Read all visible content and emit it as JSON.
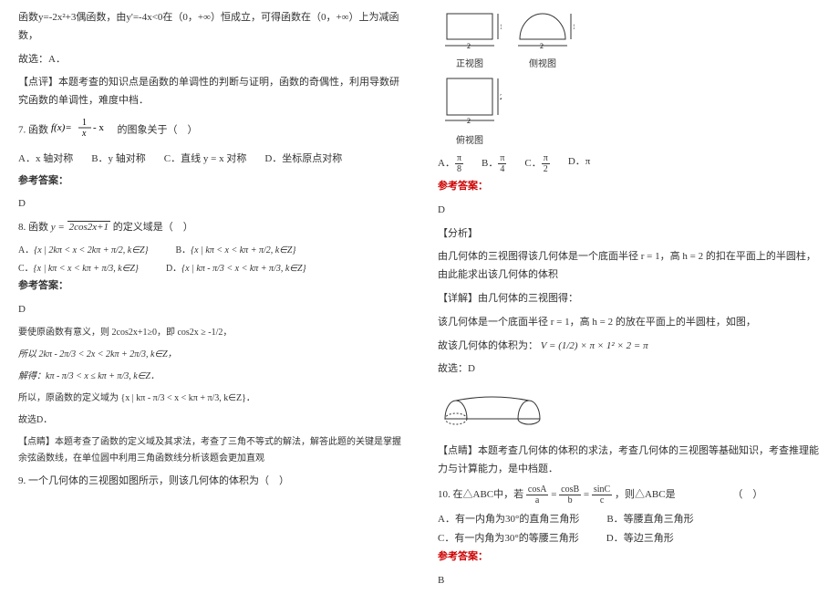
{
  "left": {
    "p1": "函数y=-2x²+3偶函数，由y'=-4x<0在（0，+∞）恒成立，可得函数在（0，+∞）上为减函数，",
    "p2": "故选：A．",
    "p3": "【点评】本题考查的知识点是函数的单调性的判断与证明，函数的奇偶性，利用导数研究函数的单调性，难度中档．",
    "q7_label": "7. 函数",
    "q7_rest": " 的图象关于（　）",
    "q7_optA": "A．x 轴对称",
    "q7_optB": "B．y 轴对称",
    "q7_optC": "C．直线 y = x 对称",
    "q7_optD": "D．坐标原点对称",
    "ans7_label": "参考答案：",
    "ans7": "D",
    "q8_label": "8. 函数",
    "q8_expr": "y = √(2cos2x+1)",
    "q8_rest": "  的定义域是（　）",
    "q8_optA_prefix": "A．",
    "q8_optA": "{x | 2kπ < x < 2kπ + π/2, k∈Z}",
    "q8_optB_prefix": "B．",
    "q8_optB": "{x | kπ < x < kπ + π/2, k∈Z}",
    "q8_optC_prefix": "C．",
    "q8_optC": "{x | kπ < x < kπ + π/3, k∈Z}",
    "q8_optD_prefix": "D．",
    "q8_optD": "{x | kπ - π/3 < x < kπ + π/3, k∈Z}",
    "ans8_label": "参考答案：",
    "ans8": "D",
    "sol8_1": "要使原函数有意义，则 2cos2x+1≥0，即 cos2x ≥ -1/2，",
    "sol8_2": "所以 2kπ - 2π/3 < 2x < 2kπ + 2π/3, k∈Z，",
    "sol8_3": "解得：kπ - π/3 < x ≤ kπ + π/3, k∈Z．",
    "sol8_4": "所以，原函数的定义域为 {x | kπ - π/3 < x < kπ + π/3, k∈Z}．",
    "sol8_5": "故选D．",
    "sol8_6": "【点睛】本题考查了函数的定义域及其求法，考查了三角不等式的解法，解答此题的关键是掌握余弦函数线，在单位圆中利用三角函数线分析该题会更加直观",
    "q9": "9. 一个几何体的三视图如图所示，则该几何体的体积为（　）"
  },
  "right": {
    "fig_front": "正视图",
    "fig_side": "侧视图",
    "fig_top": "俯视图",
    "q9_optA": "A．π/8",
    "q9_optB": "B．π/4",
    "q9_optC": "C．π/2",
    "q9_optD": "D．π",
    "ans9_label": "参考答案：",
    "ans9": "D",
    "analysis_label": "【分析】",
    "analysis1": "由几何体的三视图得该几何体是一个底面半径 r = 1，高 h = 2 的扣在平面上的半圆柱，由此能求出该几何体的体积",
    "detail_label": "【详解】由几何体的三视图得：",
    "detail1": "该几何体是一个底面半径 r = 1，高 h = 2 的放在平面上的半圆柱，如图，",
    "detail2_pre": "故该几何体的体积为：",
    "detail2_expr": "V = (1/2) × π × 1² × 2 = π",
    "detail3": "故选：D",
    "comment_label": "【点睛】本题考查几何体的体积的求法，考查几何体的三视图等基础知识，考查推理能力与计算能力，是中档题．",
    "q10_pre": "10. 在△ABC中，若 ",
    "q10_expr": "cosA/a = cosB/b = sinC/c",
    "q10_post": " ，则△ABC是",
    "q10_blank": "（　）",
    "q10_optA": "A．有一内角为30°的直角三角形",
    "q10_optB": "B．等腰直角三角形",
    "q10_optC": "C．有一内角为30°的等腰三角形",
    "q10_optD": "D．等边三角形",
    "ans10_label": "参考答案：",
    "ans10": "B"
  }
}
